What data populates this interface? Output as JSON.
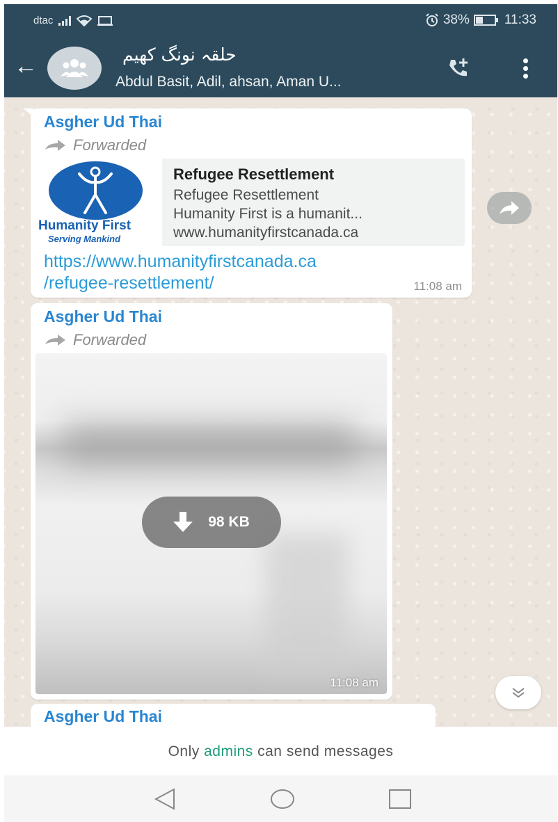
{
  "status_bar": {
    "carrier": "dtac",
    "battery_percent": "38%",
    "time": "11:33",
    "icons": [
      "signal-icon",
      "wifi-icon",
      "cast-icon",
      "alarm-icon",
      "battery-icon"
    ]
  },
  "header": {
    "group_name": "حلقہ نونگ کھیم",
    "participants": "Abdul Basit, Adil, ahsan, Aman U...",
    "icons": [
      "back-arrow-icon",
      "group-avatar-icon",
      "add-call-icon",
      "more-vert-icon"
    ]
  },
  "messages": [
    {
      "sender": "Asgher Ud Thai",
      "forwarded_label": "Forwarded",
      "preview": {
        "logo_text": "Humanity First",
        "logo_tagline": "Serving Mankind",
        "title": "Refugee Resettlement",
        "line1": "Refugee Resettlement",
        "line2": "Humanity First is a humanit...",
        "domain": "www.humanityfirstcanada.ca"
      },
      "link_line1": "https://www.humanityfirstcanada.ca",
      "link_line2": "/refugee-resettlement/",
      "time": "11:08 am"
    },
    {
      "sender": "Asgher Ud Thai",
      "forwarded_label": "Forwarded",
      "media_size": "98 KB",
      "time": "11:08 am"
    },
    {
      "sender": "Asgher Ud Thai"
    }
  ],
  "footer": {
    "msg_prefix": "Only ",
    "msg_admins": "admins",
    "msg_suffix": " can send messages"
  },
  "colors": {
    "header_bg": "#2c4a5c",
    "sender": "#2a86d1",
    "link": "#2a9bd8",
    "admins": "#1f9c79",
    "chat_bg": "#ece5dd"
  }
}
